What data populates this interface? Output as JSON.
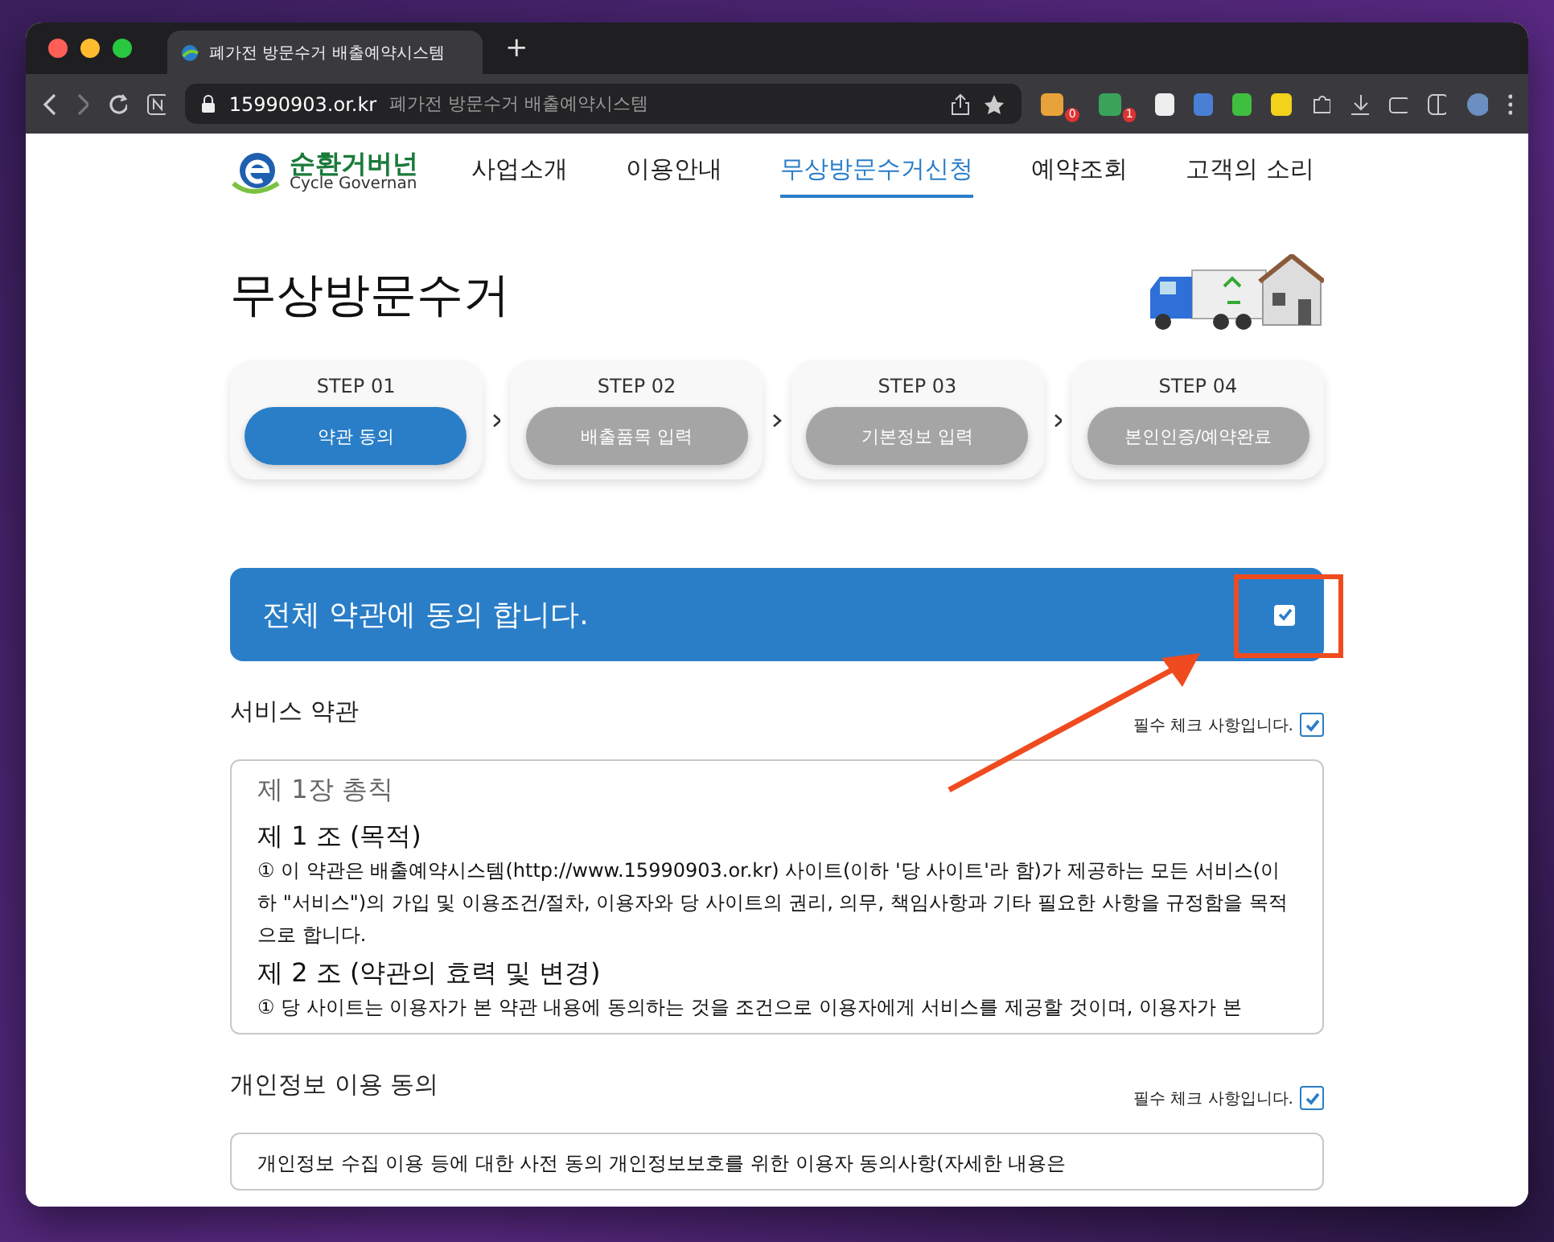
{
  "browser": {
    "tab_title": "폐가전 방문수거 배출예약시스템",
    "new_tab": "+",
    "url_domain": "15990903.or.kr",
    "url_title": "폐가전 방문수거 배출예약시스템",
    "extension_badges": [
      "0",
      "1"
    ]
  },
  "site": {
    "logo_title": "순환거버넌",
    "logo_subtitle": "Cycle Governan",
    "nav": [
      {
        "label": "사업소개",
        "selected": false
      },
      {
        "label": "이용안내",
        "selected": false
      },
      {
        "label": "무상방문수거신청",
        "selected": true
      },
      {
        "label": "예약조회",
        "selected": false
      },
      {
        "label": "고객의 소리",
        "selected": false
      }
    ]
  },
  "page": {
    "title": "무상방문수거",
    "steps": [
      {
        "step": "STEP 01",
        "label": "약관 동의",
        "selected": true
      },
      {
        "step": "STEP 02",
        "label": "배출품목 입력",
        "selected": false
      },
      {
        "step": "STEP 03",
        "label": "기본정보 입력",
        "selected": false
      },
      {
        "step": "STEP 04",
        "label": "본인인증/예약완료",
        "selected": false
      }
    ],
    "agree_all": {
      "label": "전체 약관에 동의 합니다.",
      "checked": true
    },
    "sections": [
      {
        "title": "서비스 약관",
        "required_label": "필수 체크 사항입니다.",
        "checked": true,
        "content": [
          {
            "kind": "chapter",
            "text": "제 1장 총칙"
          },
          {
            "kind": "article",
            "text": "제 1 조 (목적)"
          },
          {
            "kind": "paragraph",
            "text": "① 이 약관은 배출예약시스템(http://www.15990903.or.kr) 사이트(이하 '당 사이트'라 함)가 제공하는 모든 서비스(이하 \"서비스\")의 가입 및 이용조건/절차, 이용자와 당 사이트의 권리, 의무, 책임사항과 기타 필요한 사항을 규정함을 목적으로 합니다."
          },
          {
            "kind": "article",
            "text": "제 2 조 (약관의 효력 및 변경)"
          },
          {
            "kind": "paragraph",
            "text": "① 당 사이트는 이용자가 본 약관 내용에 동의하는 것을 조건으로 이용자에게 서비스를 제공할 것이며, 이용자가 본"
          }
        ]
      },
      {
        "title": "개인정보 이용 동의",
        "required_label": "필수 체크 사항입니다.",
        "checked": true,
        "content": [
          {
            "kind": "paragraph",
            "text": "개인정보 수집 이용 등에 대한 사전 동의 개인정보보호를 위한 이용자 동의사항(자세한 내용은"
          }
        ]
      }
    ]
  }
}
